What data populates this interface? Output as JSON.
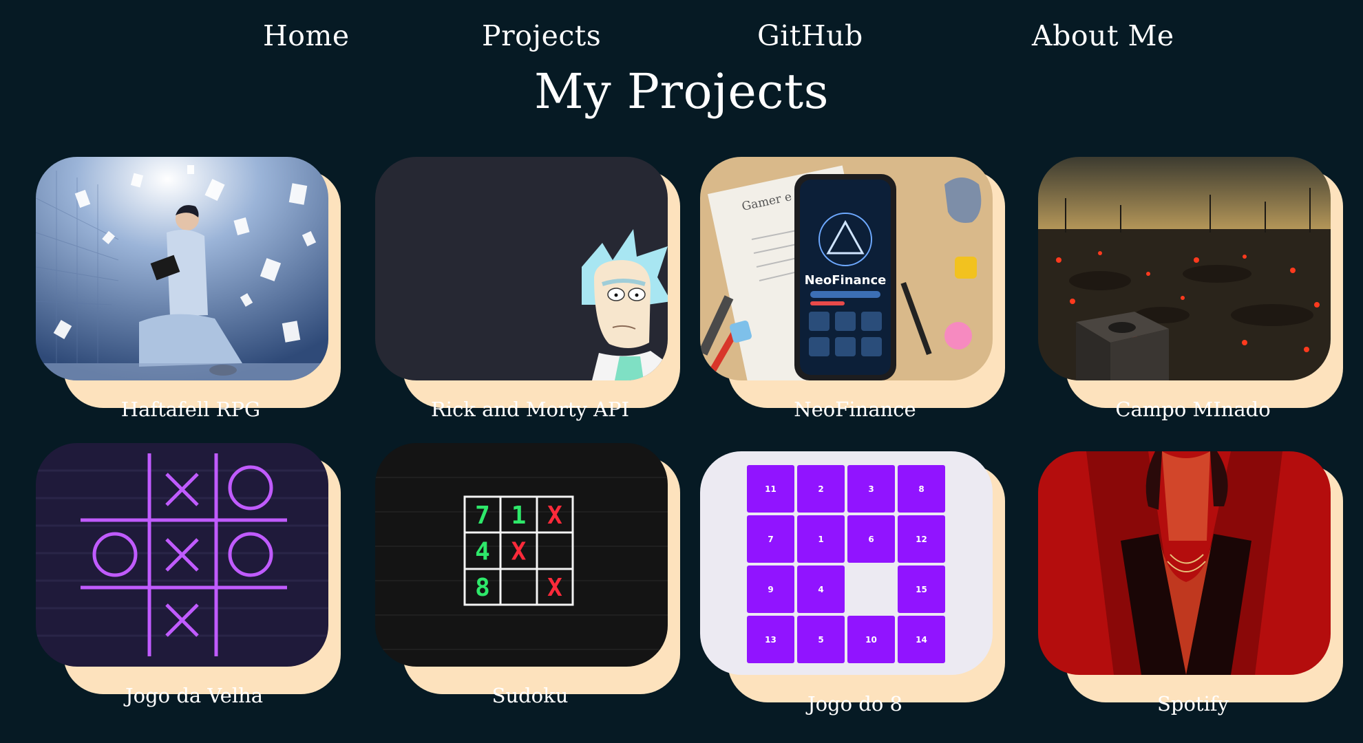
{
  "nav": {
    "home": "Home",
    "projects": "Projects",
    "github": "GitHub",
    "about": "About Me"
  },
  "page_title": "My Projects",
  "projects": [
    {
      "label": "Haftafell RPG",
      "image": "boy-reading-book-with-floating-cards"
    },
    {
      "label": "Rick and Morty API",
      "image": "rick-character-on-dark-background"
    },
    {
      "label": "NeoFinance",
      "image": "phone-app-on-desk"
    },
    {
      "label": "Campo MInado",
      "image": "dark-minefield-landscape"
    },
    {
      "label": "Jogo da Velha",
      "image": "neon-tic-tac-toe-board"
    },
    {
      "label": "Sudoku",
      "image": "neon-sudoku-grid"
    },
    {
      "label": "Jogo do 8",
      "image": "sliding-number-puzzle"
    },
    {
      "label": "Spotify",
      "image": "man-on-red-background"
    }
  ],
  "neofinance": {
    "app_name": "NeoFinance",
    "paper_heading": "Gamer e"
  },
  "sudoku_cells": [
    "7",
    "1",
    "X",
    "4",
    "X",
    "",
    "8",
    "",
    "X"
  ],
  "puzzle_tiles": [
    "11",
    "2",
    "3",
    "8",
    "7",
    "1",
    "6",
    "12",
    "9",
    "4",
    "",
    "15",
    "13",
    "5",
    "10",
    "14"
  ],
  "colors": {
    "background": "#061a24",
    "card_shadow": "#fde2bd",
    "text": "#ffffff",
    "puzzle_tile": "#9114ff",
    "spotify_red": "#b40d0d",
    "neon_purple": "#c05bff",
    "neon_green": "#2ee86a",
    "neon_red": "#ff2a3a"
  }
}
